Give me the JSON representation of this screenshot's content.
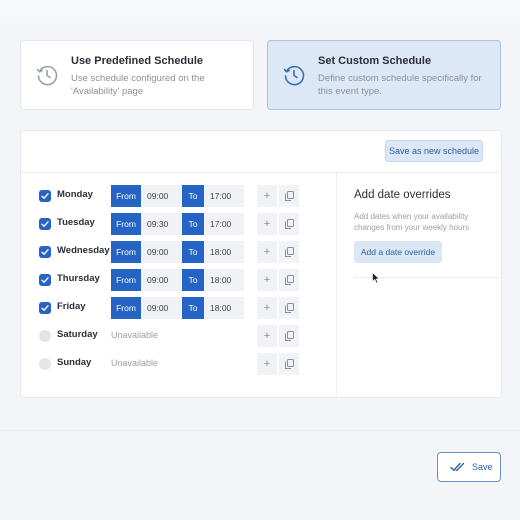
{
  "schedule_options": {
    "predefined": {
      "title": "Use Predefined Schedule",
      "description": "Use schedule configured on the 'Availability' page",
      "icon": "clock-icon"
    },
    "custom": {
      "title": "Set Custom Schedule",
      "description": "Define custom schedule specifically for this event type.",
      "icon": "clock-icon",
      "selected": true
    }
  },
  "panel": {
    "save_new_label": "Save as new schedule",
    "from_label": "From",
    "to_label": "To",
    "add_symbol": "+",
    "days": [
      {
        "name": "Monday",
        "checked": true,
        "start": "09:00",
        "end": "17:00"
      },
      {
        "name": "Tuesday",
        "checked": true,
        "start": "09:30",
        "end": "17:00"
      },
      {
        "name": "Wednesday",
        "checked": true,
        "start": "09:00",
        "end": "18:00"
      },
      {
        "name": "Thursday",
        "checked": true,
        "start": "09:00",
        "end": "18:00"
      },
      {
        "name": "Friday",
        "checked": true,
        "start": "09:00",
        "end": "18:00"
      },
      {
        "name": "Saturday",
        "checked": false,
        "unavailable_label": "Unavailable"
      },
      {
        "name": "Sunday",
        "checked": false,
        "unavailable_label": "Unavailable"
      }
    ]
  },
  "overrides": {
    "title": "Add date overrides",
    "description": "Add dates when your availability changes from your weekly hours",
    "button_label": "Add a date override"
  },
  "footer": {
    "save_label": "Save"
  },
  "colors": {
    "accent": "#2563c4",
    "selected_card": "#dce8f6",
    "button_light": "#dbe7f5"
  }
}
